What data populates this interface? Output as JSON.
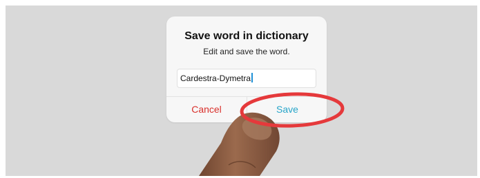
{
  "dialog": {
    "title": "Save word in dictionary",
    "subtitle": "Edit and save the word.",
    "input_value": "Cardestra-Dymetra",
    "cancel_label": "Cancel",
    "save_label": "Save"
  },
  "colors": {
    "background": "#d9d9d9",
    "dialog": "#f7f7f7",
    "cancel": "#d9302b",
    "save": "#27a5c9",
    "highlight_ring": "#e5393b",
    "finger": "#8a5a3f"
  },
  "icons": {
    "highlight": "highlight-ring-icon",
    "finger": "finger-pointer-icon"
  }
}
